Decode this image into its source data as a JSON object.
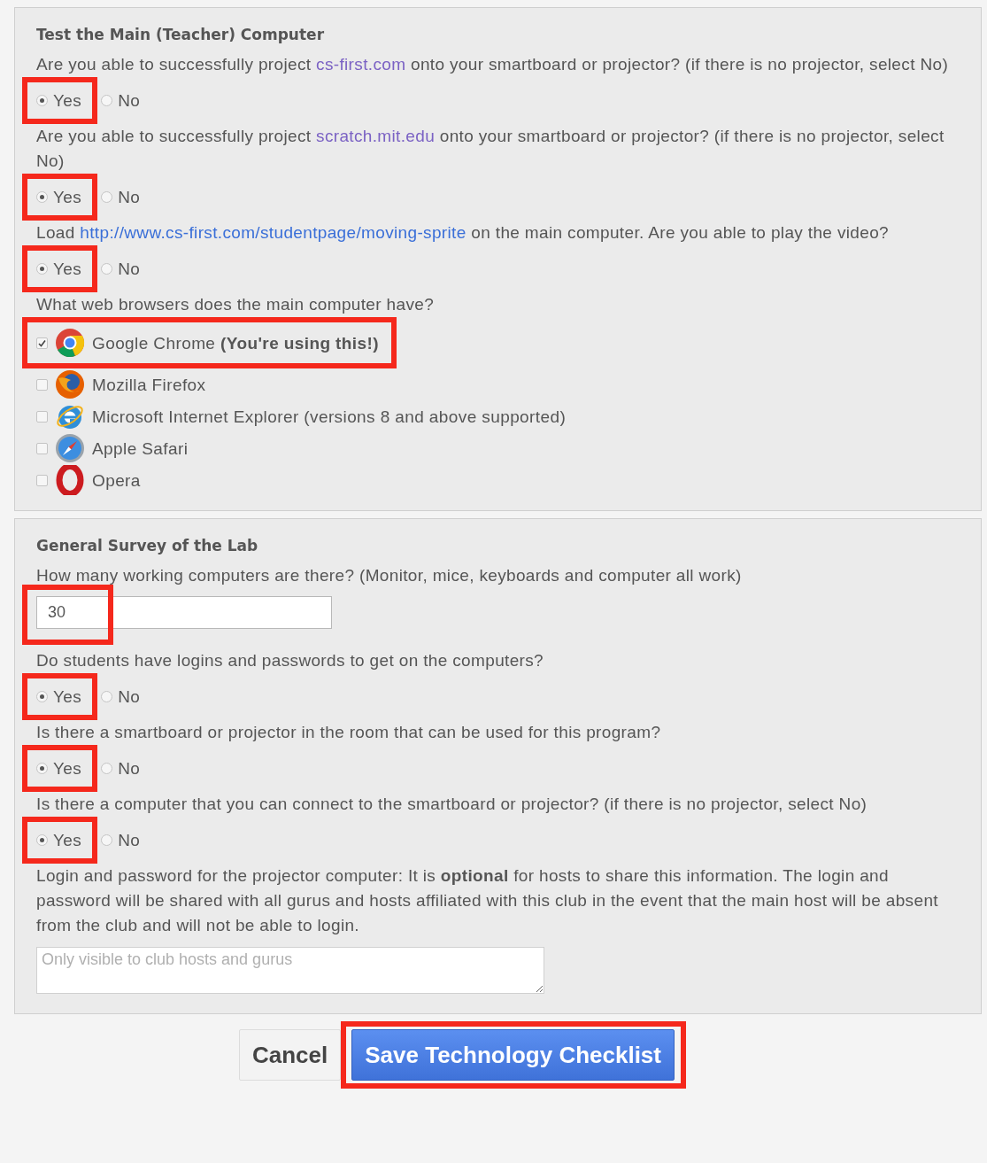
{
  "sections": [
    {
      "title": "Test the Main (Teacher) Computer",
      "questions": [
        {
          "kind": "radio",
          "parts": [
            {
              "kind": "text",
              "text": "Are you able to successfully project "
            },
            {
              "kind": "link",
              "text": "cs-first.com",
              "visited": true
            },
            {
              "kind": "text",
              "text": " onto your smartboard or projector? (if there is no projector, select No)"
            }
          ],
          "options": [
            {
              "label": "Yes",
              "selected": true,
              "highlighted": true
            },
            {
              "label": "No",
              "selected": false,
              "highlighted": false
            }
          ]
        },
        {
          "kind": "radio",
          "parts": [
            {
              "kind": "text",
              "text": "Are you able to successfully project "
            },
            {
              "kind": "link",
              "text": "scratch.mit.edu",
              "visited": true
            },
            {
              "kind": "text",
              "text": " onto your smartboard or projector? (if there is no projector, select No)"
            }
          ],
          "options": [
            {
              "label": "Yes",
              "selected": true,
              "highlighted": true
            },
            {
              "label": "No",
              "selected": false,
              "highlighted": false
            }
          ]
        },
        {
          "kind": "radio",
          "parts": [
            {
              "kind": "text",
              "text": "Load "
            },
            {
              "kind": "link",
              "text": "http://www.cs-first.com/studentpage/moving-sprite",
              "visited": false
            },
            {
              "kind": "text",
              "text": " on the main computer. Are you able to play the video?"
            }
          ],
          "options": [
            {
              "label": "Yes",
              "selected": true,
              "highlighted": true
            },
            {
              "label": "No",
              "selected": false,
              "highlighted": false
            }
          ]
        },
        {
          "kind": "checkboxes",
          "parts": [
            {
              "kind": "text",
              "text": "What web browsers does the main computer have?"
            }
          ],
          "options": [
            {
              "label": "Google Chrome **(You're using this!)**",
              "kind": "chrome",
              "checked": true,
              "highlighted": true
            },
            {
              "label": "Mozilla Firefox",
              "kind": "firefox",
              "checked": false,
              "highlighted": false
            },
            {
              "label": "Microsoft Internet Explorer (versions 8 and above supported)",
              "kind": "ie",
              "checked": false,
              "highlighted": false
            },
            {
              "label": "Apple Safari",
              "kind": "safari",
              "checked": false,
              "highlighted": false
            },
            {
              "label": "Opera",
              "kind": "opera",
              "checked": false,
              "highlighted": false
            }
          ]
        }
      ]
    },
    {
      "title": "General Survey of the Lab",
      "questions": [
        {
          "kind": "number",
          "parts": [
            {
              "kind": "text",
              "text": "How many working computers are there? (Monitor, mice, keyboards and computer all work)"
            }
          ],
          "value": "30",
          "highlighted": true
        },
        {
          "kind": "radio",
          "parts": [
            {
              "kind": "text",
              "text": "Do students have logins and passwords to get on the computers?"
            }
          ],
          "options": [
            {
              "label": "Yes",
              "selected": true,
              "highlighted": true
            },
            {
              "label": "No",
              "selected": false,
              "highlighted": false
            }
          ]
        },
        {
          "kind": "radio",
          "parts": [
            {
              "kind": "text",
              "text": "Is there a smartboard or projector in the room that can be used for this program?"
            }
          ],
          "options": [
            {
              "label": "Yes",
              "selected": true,
              "highlighted": true
            },
            {
              "label": "No",
              "selected": false,
              "highlighted": false
            }
          ]
        },
        {
          "kind": "radio",
          "parts": [
            {
              "kind": "text",
              "text": "Is there a computer that you can connect to the smartboard or projector? (if there is no projector, select No)"
            }
          ],
          "options": [
            {
              "label": "Yes",
              "selected": true,
              "highlighted": true
            },
            {
              "label": "No",
              "selected": false,
              "highlighted": false
            }
          ]
        },
        {
          "kind": "textarea",
          "parts": [
            {
              "kind": "text",
              "text": "Login and password for the projector computer: It is **optional** for hosts to share this information. The login and password will be shared with all gurus and hosts affiliated with this club in the event that the main host will be absent from the club and will not be able to login."
            }
          ],
          "placeholder": "Only visible to club hosts and gurus"
        }
      ]
    }
  ],
  "buttons": [
    {
      "kind": "cancel",
      "label": "Cancel",
      "highlighted": false
    },
    {
      "kind": "primary",
      "label": "Save Technology Checklist",
      "highlighted": true
    }
  ]
}
